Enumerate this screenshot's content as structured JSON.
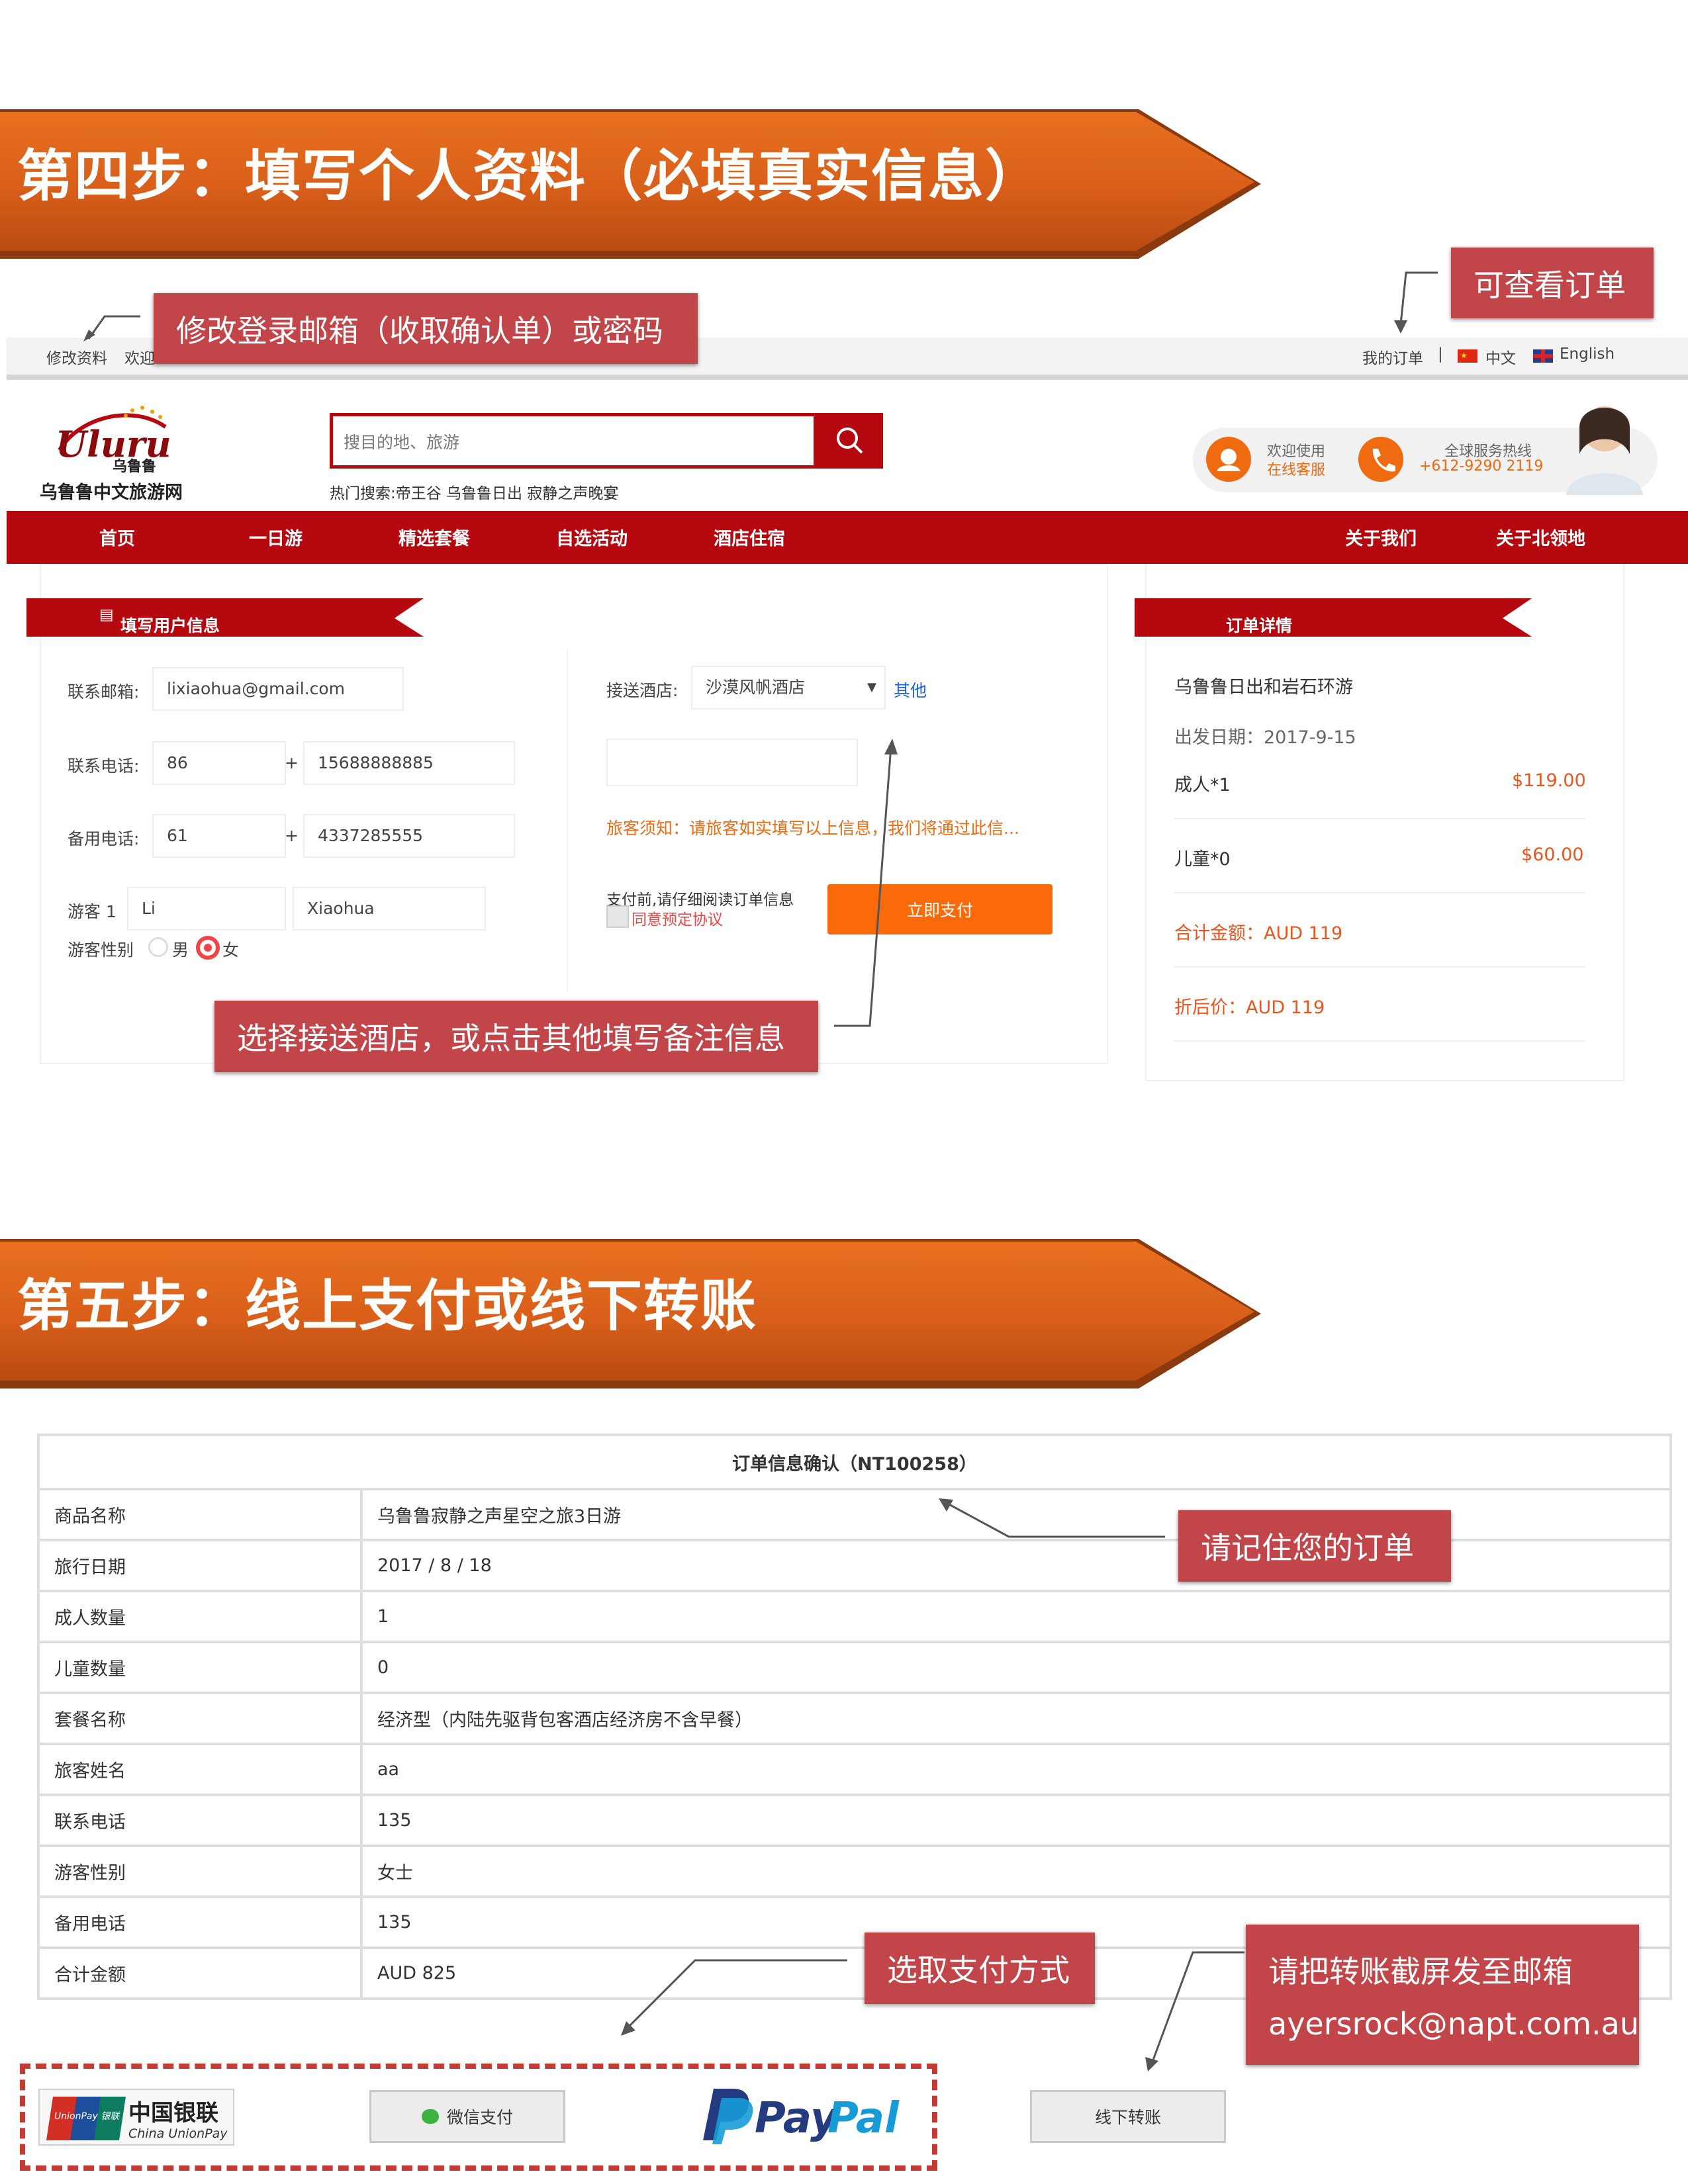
{
  "step4": {
    "title": "第四步：填写个人资料（必填真实信息）",
    "callout_email": "修改登录邮箱（收取确认单）或密码",
    "callout_orders": "可查看订单",
    "callout_hotel": "选择接送酒店，或点击其他填写备注信息"
  },
  "site": {
    "topbar": {
      "edit_profile": "修改资料",
      "welcome": "欢迎",
      "my_orders": "我的订单",
      "divider": "|",
      "lang_cn": "中文",
      "lang_en": "English"
    },
    "logo": {
      "script": "Uluru",
      "sub": "乌鲁鲁",
      "name": "乌鲁鲁中文旅游网"
    },
    "search": {
      "placeholder": "搜目的地、旅游",
      "hot": "热门搜索:帝王谷 乌鲁鲁日出 寂静之声晚宴"
    },
    "service": {
      "welcome": "欢迎使用",
      "online": "在线客服",
      "hotline_label": "全球服务热线",
      "hotline": "+612-9290 2119"
    },
    "nav": [
      "首页",
      "一日游",
      "精选套餐",
      "自选活动",
      "酒店住宿",
      "关于我们",
      "关于北领地"
    ]
  },
  "form": {
    "ribbon": "填写用户信息",
    "email_label": "联系邮箱:",
    "email": "lixiaohua@gmail.com",
    "phone_label": "联系电话:",
    "phone_code": "86",
    "plus": "+",
    "phone": "15688888885",
    "alt_phone_label": "备用电话:",
    "alt_code": "61",
    "alt_phone": "4337285555",
    "traveler_label": "游客 1",
    "first_name": "Li",
    "last_name": "Xiaohua",
    "gender_label": "游客性别",
    "male": "男",
    "female": "女",
    "hotel_label": "接送酒店:",
    "hotel_value": "沙漠风帆酒店",
    "hotel_other": "其他",
    "notice": "旅客须知：请旅客如实填写以上信息，我们将通过此信...",
    "agree_text": "支付前,请仔细阅读订单信息",
    "agree_link": "同意预定协议",
    "pay_now": "立即支付"
  },
  "order": {
    "ribbon": "订单详情",
    "product": "乌鲁鲁日出和岩石环游",
    "date": "出发日期：2017-9-15",
    "adult": "成人*1",
    "adult_price": "$119.00",
    "child": "儿童*0",
    "child_price": "$60.00",
    "total": "合计金额：AUD 119",
    "discount": "折后价：AUD 119"
  },
  "step5": {
    "title": "第五步：线上支付或线下转账",
    "callout_order": "请记住您的订单",
    "callout_pay": "选取支付方式",
    "callout_transfer_1": "请把转账截屏发至邮箱",
    "callout_transfer_2": "ayersrock@napt.com.au"
  },
  "confirm": {
    "title": "订单信息确认（NT100258）",
    "rows": [
      {
        "k": "商品名称",
        "v": "乌鲁鲁寂静之声星空之旅3日游"
      },
      {
        "k": "旅行日期",
        "v": "2017 / 8 / 18"
      },
      {
        "k": "成人数量",
        "v": "1"
      },
      {
        "k": "儿童数量",
        "v": "0"
      },
      {
        "k": "套餐名称",
        "v": "经济型（内陆先驱背包客酒店经济房不含早餐）"
      },
      {
        "k": "旅客姓名",
        "v": "aa"
      },
      {
        "k": "联系电话",
        "v": "135"
      },
      {
        "k": "游客性别",
        "v": "女士"
      },
      {
        "k": "备用电话",
        "v": "135"
      },
      {
        "k": "合计金额",
        "v": "AUD 825"
      }
    ]
  },
  "payment": {
    "unionpay_cn": "中国银联",
    "unionpay_en": "China UnionPay",
    "unionpay_badge": "UnionPay 银联",
    "wechat": "微信支付",
    "paypal_pay": "Pay",
    "paypal_pal": "Pal",
    "transfer": "线下转账"
  },
  "colors": {
    "banner": "#d95f1a",
    "brand_red": "#b5090f",
    "callout": "#c2454a",
    "pay_orange": "#fa6a0a",
    "accent_orange": "#e9551c"
  }
}
